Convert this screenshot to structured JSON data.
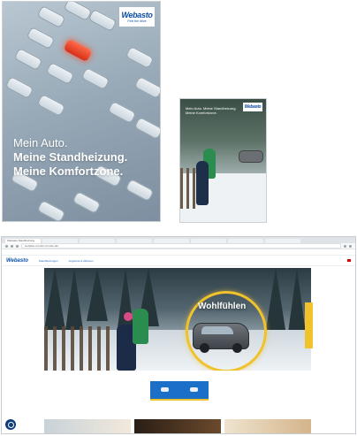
{
  "brochure_large": {
    "logo": "Webasto",
    "logo_sub": "Feel the drive",
    "headline_line1": "Mein Auto.",
    "headline_line2": "Meine Standheizung.",
    "headline_line3": "Meine Komfortzone."
  },
  "brochure_small": {
    "logo": "Webasto",
    "headline": "Mein Auto. Meine Standheizung. Meine Komfortzone."
  },
  "browser": {
    "tabs": [
      "Webasto Standheizung",
      "",
      "",
      "",
      "",
      "",
      "",
      ""
    ],
    "url": "webasto-comfort.com/de-de/",
    "bookmarks": [
      "",
      "",
      "",
      "",
      "",
      "",
      "",
      "",
      "",
      ""
    ],
    "site": {
      "logo": "Webasto",
      "nav": [
        "Standheizungen",
        "Angebote & Aktionen"
      ],
      "right_links": [
        "",
        "",
        "",
        ""
      ]
    },
    "hero": {
      "title": "Wohlfühlen",
      "cta_labels": [
        "",
        ""
      ]
    }
  },
  "colors": {
    "brand_blue": "#0e4fa4",
    "accent_yellow": "#f0c22b",
    "cta_blue": "#1c6fc7",
    "highlight_car": "#e03a1f"
  }
}
